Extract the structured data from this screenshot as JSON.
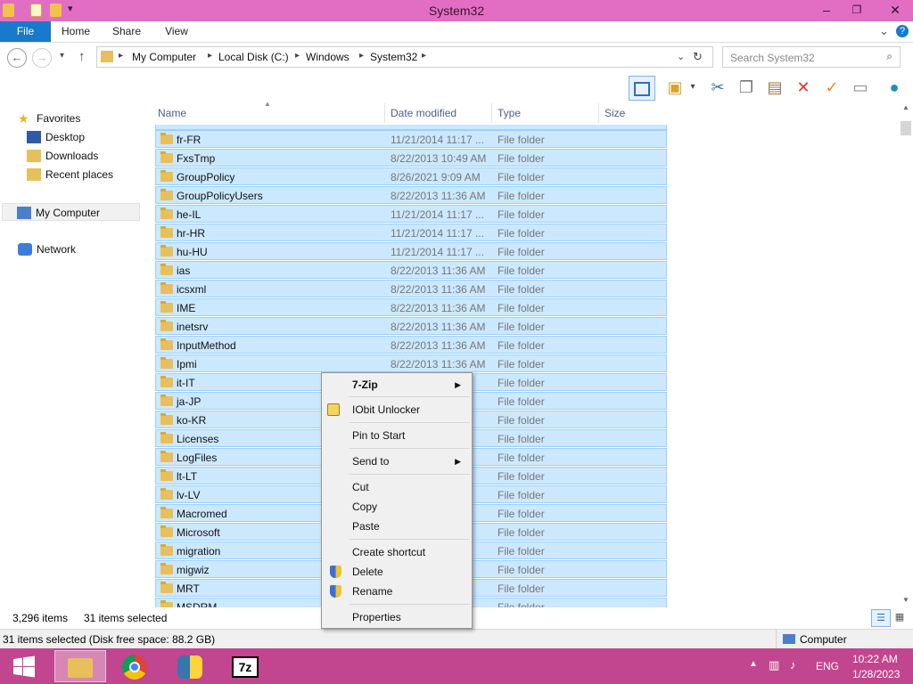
{
  "window": {
    "title": "System32"
  },
  "ribbon": {
    "tabs": [
      "File",
      "Home",
      "Share",
      "View"
    ]
  },
  "address": {
    "crumbs": [
      "My Computer",
      "Local Disk (C:)",
      "Windows",
      "System32"
    ],
    "search_placeholder": "Search System32"
  },
  "navpane": {
    "favorites": "Favorites",
    "desktop": "Desktop",
    "downloads": "Downloads",
    "recent": "Recent places",
    "computer": "My Computer",
    "network": "Network"
  },
  "columns": {
    "name": "Name",
    "date": "Date modified",
    "type": "Type",
    "size": "Size"
  },
  "rows": [
    {
      "name": "fr-FR",
      "date": "11/21/2014 11:17 ...",
      "type": "File folder"
    },
    {
      "name": "FxsTmp",
      "date": "8/22/2013 10:49 AM",
      "type": "File folder"
    },
    {
      "name": "GroupPolicy",
      "date": "8/26/2021 9:09 AM",
      "type": "File folder"
    },
    {
      "name": "GroupPolicyUsers",
      "date": "8/22/2013 11:36 AM",
      "type": "File folder"
    },
    {
      "name": "he-IL",
      "date": "11/21/2014 11:17 ...",
      "type": "File folder"
    },
    {
      "name": "hr-HR",
      "date": "11/21/2014 11:17 ...",
      "type": "File folder"
    },
    {
      "name": "hu-HU",
      "date": "11/21/2014 11:17 ...",
      "type": "File folder"
    },
    {
      "name": "ias",
      "date": "8/22/2013 11:36 AM",
      "type": "File folder"
    },
    {
      "name": "icsxml",
      "date": "8/22/2013 11:36 AM",
      "type": "File folder"
    },
    {
      "name": "IME",
      "date": "8/22/2013 11:36 AM",
      "type": "File folder"
    },
    {
      "name": "inetsrv",
      "date": "8/22/2013 11:36 AM",
      "type": "File folder"
    },
    {
      "name": "InputMethod",
      "date": "8/22/2013 11:36 AM",
      "type": "File folder"
    },
    {
      "name": "Ipmi",
      "date": "8/22/2013 11:36 AM",
      "type": "File folder"
    },
    {
      "name": "it-IT",
      "date": "",
      "type": "File folder"
    },
    {
      "name": "ja-JP",
      "date": "",
      "type": "File folder"
    },
    {
      "name": "ko-KR",
      "date": "",
      "type": "File folder"
    },
    {
      "name": "Licenses",
      "date": "M",
      "type": "File folder"
    },
    {
      "name": "LogFiles",
      "date": "M",
      "type": "File folder"
    },
    {
      "name": "lt-LT",
      "date": "",
      "type": "File folder"
    },
    {
      "name": "lv-LV",
      "date": "",
      "type": "File folder"
    },
    {
      "name": "Macromed",
      "date": "M",
      "type": "File folder"
    },
    {
      "name": "Microsoft",
      "date": "M",
      "type": "File folder"
    },
    {
      "name": "migration",
      "date": "M",
      "type": "File folder"
    },
    {
      "name": "migwiz",
      "date": "M",
      "type": "File folder"
    },
    {
      "name": "MRT",
      "date": "M",
      "type": "File folder"
    },
    {
      "name": "MSDRM",
      "date": "M",
      "type": "File folder"
    }
  ],
  "status": {
    "items": "3,296 items",
    "selected": "31 items selected",
    "detail": "31 items selected (Disk free space: 88.2 GB)",
    "computer": "Computer"
  },
  "context_menu": {
    "zip": "7-Zip",
    "iobit": "IObit Unlocker",
    "pin": "Pin to Start",
    "sendto": "Send to",
    "cut": "Cut",
    "copy": "Copy",
    "paste": "Paste",
    "shortcut": "Create shortcut",
    "delete": "Delete",
    "rename": "Rename",
    "properties": "Properties"
  },
  "taskbar": {
    "lang": "ENG",
    "time": "10:22 AM",
    "date": "1/28/2023",
    "zip_label": "7z"
  },
  "colors": {
    "titlebar": "#e26ec4",
    "taskbar": "#c2458f",
    "file_tab": "#1979ca",
    "selection": "#cce8ff"
  }
}
